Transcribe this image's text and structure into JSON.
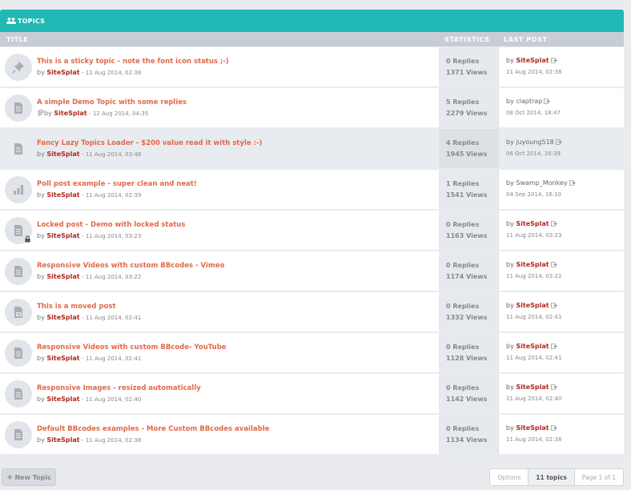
{
  "header": {
    "title": "TOPICS",
    "icon": "users-icon"
  },
  "columns": {
    "title": "TITLE",
    "statistics": "STATISTICS",
    "last_post": "LAST POST"
  },
  "topics": [
    {
      "title": "This is a sticky topic - note the font icon status ;-)",
      "by": "by",
      "author": "SiteSplat",
      "date": "- 11 Aug 2014, 02:38",
      "replies": "0 Replies",
      "views": "1371 Views",
      "last_by": "by",
      "last_user": "SiteSplat",
      "last_user_highlight": true,
      "last_date": "11 Aug 2014, 02:38",
      "icon": "pin-icon",
      "attachment": false,
      "locked": false
    },
    {
      "title": "A simple Demo Topic with some replies",
      "by": "by",
      "author": "SiteSplat",
      "date": "- 12 Aug 2014, 04:35",
      "replies": "5 Replies",
      "views": "2279 Views",
      "last_by": "by",
      "last_user": "claptrap",
      "last_user_highlight": false,
      "last_date": "08 Oct 2014, 18:47",
      "icon": "document-icon",
      "attachment": true,
      "locked": false
    },
    {
      "title": "Fancy Lazy Topics Loader - $200 value read it with style :-)",
      "by": "by",
      "author": "SiteSplat",
      "date": "- 11 Aug 2014, 03:48",
      "replies": "4 Replies",
      "views": "1945 Views",
      "last_by": "by",
      "last_user": "juyoung518",
      "last_user_highlight": false,
      "last_date": "06 Oct 2014, 16:39",
      "icon": "document-icon",
      "attachment": false,
      "locked": false,
      "highlight": true
    },
    {
      "title": "Poll post example - super clean and neat!",
      "by": "by",
      "author": "SiteSplat",
      "date": "- 11 Aug 2014, 02:39",
      "replies": "1 Replies",
      "views": "1541 Views",
      "last_by": "by",
      "last_user": "Swamp_Monkey",
      "last_user_highlight": false,
      "last_date": "04 Sep 2014, 16:10",
      "icon": "poll-icon",
      "attachment": false,
      "locked": false
    },
    {
      "title": "Locked post - Demo with locked status",
      "by": "by",
      "author": "SiteSplat",
      "date": "- 11 Aug 2014, 03:23",
      "replies": "0 Replies",
      "views": "1163 Views",
      "last_by": "by",
      "last_user": "SiteSplat",
      "last_user_highlight": true,
      "last_date": "11 Aug 2014, 03:23",
      "icon": "document-icon",
      "attachment": false,
      "locked": true
    },
    {
      "title": "Responsive Videos with custom BBcodes - Vimeo",
      "by": "by",
      "author": "SiteSplat",
      "date": "- 11 Aug 2014, 03:22",
      "replies": "0 Replies",
      "views": "1174 Views",
      "last_by": "by",
      "last_user": "SiteSplat",
      "last_user_highlight": true,
      "last_date": "11 Aug 2014, 03:22",
      "icon": "document-icon",
      "attachment": false,
      "locked": false
    },
    {
      "title": "This is a moved post",
      "by": "by",
      "author": "SiteSplat",
      "date": "- 11 Aug 2014, 02:41",
      "replies": "0 Replies",
      "views": "1332 Views",
      "last_by": "by",
      "last_user": "SiteSplat",
      "last_user_highlight": true,
      "last_date": "11 Aug 2014, 02:41",
      "icon": "moved-icon",
      "attachment": false,
      "locked": false
    },
    {
      "title": "Responsive Videos with custom BBcode- YouTube",
      "by": "by",
      "author": "SiteSplat",
      "date": "- 11 Aug 2014, 02:41",
      "replies": "0 Replies",
      "views": "1128 Views",
      "last_by": "by",
      "last_user": "SiteSplat",
      "last_user_highlight": true,
      "last_date": "11 Aug 2014, 02:41",
      "icon": "document-icon",
      "attachment": false,
      "locked": false
    },
    {
      "title": "Responsive Images - resized automatically",
      "by": "by",
      "author": "SiteSplat",
      "date": "- 11 Aug 2014, 02:40",
      "replies": "0 Replies",
      "views": "1142 Views",
      "last_by": "by",
      "last_user": "SiteSplat",
      "last_user_highlight": true,
      "last_date": "11 Aug 2014, 02:40",
      "icon": "document-icon",
      "attachment": false,
      "locked": false
    },
    {
      "title": "Default BBcodes examples - More Custom BBcodes available",
      "by": "by",
      "author": "SiteSplat",
      "date": "- 11 Aug 2014, 02:38",
      "replies": "0 Replies",
      "views": "1134 Views",
      "last_by": "by",
      "last_user": "SiteSplat",
      "last_user_highlight": true,
      "last_date": "11 Aug 2014, 02:38",
      "icon": "document-icon",
      "attachment": false,
      "locked": false
    }
  ],
  "footer": {
    "new_topic": "New Topic",
    "options": "Options",
    "count": "11 topics",
    "page": "Page 1 of 1"
  },
  "colors": {
    "accent": "#1fb8b4",
    "title": "#e06a4a",
    "user": "#b0281e"
  }
}
